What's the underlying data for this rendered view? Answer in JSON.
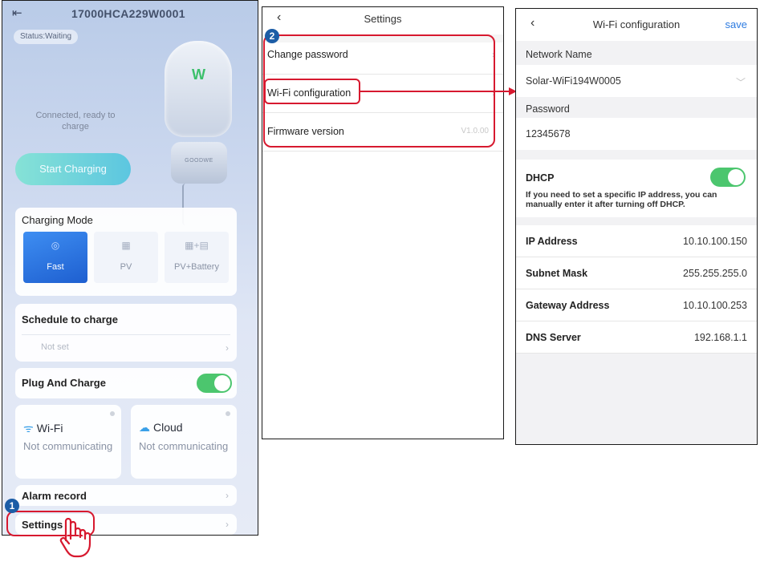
{
  "screen1": {
    "serial": "17000HCA229W0001",
    "status": "Status:Waiting",
    "charger_brand": "GOODWE",
    "connection_text": "Connected, ready to charge",
    "start_button": "Start Charging",
    "charging_mode": {
      "title": "Charging Mode",
      "options": [
        {
          "label": "Fast",
          "selected": true
        },
        {
          "label": "PV",
          "selected": false
        },
        {
          "label": "PV+Battery",
          "selected": false
        }
      ]
    },
    "schedule": {
      "title": "Schedule to charge",
      "value": "Not set"
    },
    "plug_and_charge": {
      "label": "Plug And Charge",
      "enabled": true
    },
    "wifi": {
      "label": "Wi-Fi",
      "status": "Not communicating"
    },
    "cloud": {
      "label": "Cloud",
      "status": "Not communicating"
    },
    "alarm_record": "Alarm record",
    "settings": "Settings",
    "step_badge": "1"
  },
  "screen2": {
    "title": "Settings",
    "step_badge": "2",
    "items": [
      {
        "label": "Change password"
      },
      {
        "label": "Wi-Fi configuration"
      },
      {
        "label": "Firmware version",
        "value": "V1.0.00"
      }
    ]
  },
  "screen3": {
    "title": "Wi-Fi configuration",
    "save": "save",
    "network_name_label": "Network Name",
    "network_name": "Solar-WiFi194W0005",
    "password_label": "Password",
    "password": "12345678",
    "dhcp_label": "DHCP",
    "dhcp_enabled": true,
    "dhcp_note": "If you need to set a specific IP address, you can manually enter it after turning off DHCP.",
    "fields": [
      {
        "label": "IP Address",
        "value": "10.10.100.150"
      },
      {
        "label": "Subnet Mask",
        "value": "255.255.255.0"
      },
      {
        "label": "Gateway Address",
        "value": "10.10.100.253"
      },
      {
        "label": "DNS Server",
        "value": "192.168.1.1"
      }
    ]
  },
  "colors": {
    "highlight": "#d7192f",
    "badge": "#1c5da6",
    "toggle_on": "#4cc66e",
    "accent": "#2d7be0"
  }
}
